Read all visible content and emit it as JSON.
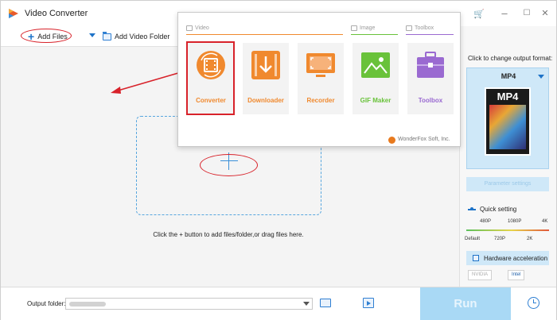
{
  "window": {
    "title": "Video Converter",
    "controls": {
      "minimize": "–",
      "maximize": "☐",
      "close": "✕"
    }
  },
  "toolbar": {
    "add_files": "Add Files",
    "add_folder": "Add Video Folder"
  },
  "drop_zone": {
    "hint": "Click the + button to add files/folder,or drag files here."
  },
  "popup": {
    "sections": [
      {
        "label": "Video"
      },
      {
        "label": "Image"
      },
      {
        "label": "Toolbox"
      }
    ],
    "tiles": [
      {
        "label": "Converter",
        "icon": "film-convert-icon",
        "color": "#f0892e",
        "selected": true
      },
      {
        "label": "Downloader",
        "icon": "download-icon",
        "color": "#f0892e",
        "selected": false
      },
      {
        "label": "Recorder",
        "icon": "screen-record-icon",
        "color": "#f0892e",
        "selected": false
      },
      {
        "label": "GIF Maker",
        "icon": "image-icon",
        "color": "#69c23a",
        "selected": false
      },
      {
        "label": "Toolbox",
        "icon": "toolbox-icon",
        "color": "#9a6ad1",
        "selected": false
      }
    ],
    "brand": "WonderFox Soft, Inc."
  },
  "right_panel": {
    "hint": "Click to change output format:",
    "format": "MP4",
    "format_box_label": "MP4",
    "parameter_settings": "Parameter settings",
    "quick_setting": "Quick setting",
    "quality_top": [
      "480P",
      "1080P",
      "4K"
    ],
    "quality_bottom": [
      "Default",
      "720P",
      "2K"
    ],
    "hardware_acceleration": "Hardware acceleration",
    "vendors": [
      "NVIDIA",
      "Intel"
    ]
  },
  "bottom": {
    "output_label": "Output folder:",
    "run": "Run"
  },
  "colors": {
    "accent": "#1e73c8",
    "highlight_red": "#d8222a",
    "run_button": "#a9d9f5"
  }
}
